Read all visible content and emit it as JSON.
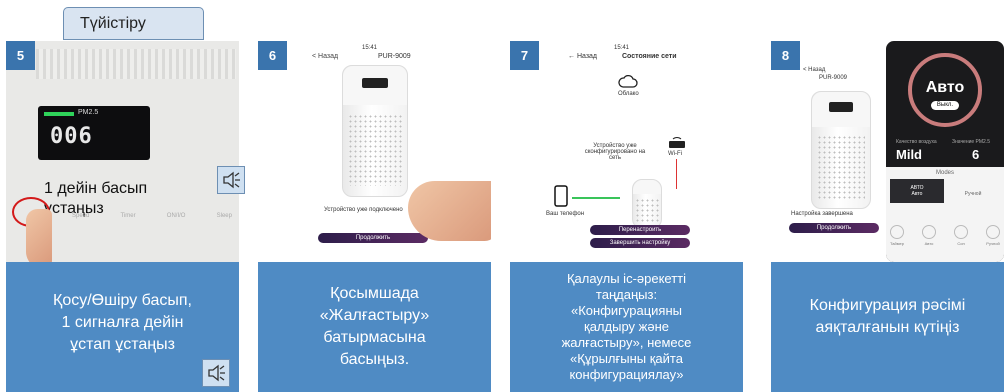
{
  "tab_label": "Түйістіру",
  "colors": {
    "panel_bg": "#4f8bc4",
    "badge_bg": "#3a74ad",
    "caption_text": "#ffffff"
  },
  "icons": {
    "speaker": "speaker-icon"
  },
  "panels": [
    {
      "number": "5",
      "caption": "Қосу/Өшіру басып,\n1 сигналға дейін\nұстап ұстаңыз",
      "device": {
        "pm_label": "PM2.5",
        "display_value": "006",
        "press_text": "1 дейін басып\nұстаңыз",
        "labels": [
          "Speed",
          "Timer",
          "ON/I/O",
          "Sleep"
        ]
      }
    },
    {
      "number": "6",
      "caption": "Қосымшада\n«Жалғастыру»\nбатырмасына\nбасыңыз.",
      "phone": {
        "time": "15:41",
        "back": "< Назад",
        "model": "PUR-9009",
        "message": "Устройство уже подключено",
        "button": "Продолжить"
      }
    },
    {
      "number": "7",
      "caption": "Қалаулы іс-әрекетті\nтаңдаңыз:\n«Конфигурацияны\nқалдыру және\nжалғастыру», немесе\n«Құрылғыны қайта\nконфигурациялау»",
      "phone": {
        "time": "15:41",
        "back": "← Назад",
        "title": "Состояние сети",
        "cloud_label": "Облако",
        "status_text": "Устройство уже\nсконфигурировано на сеть",
        "router_label": "Wi-Fi",
        "phone_label": "Ваш телефон",
        "button_primary": "Перенастроить",
        "button_secondary": "Завершить настройку"
      }
    },
    {
      "number": "8",
      "caption": "Конфигурация рәсімі\nаяқталғанын күтіңіз",
      "phone": {
        "back": "< Назад",
        "model": "PUR-9009",
        "done_text": "Настройка завершена",
        "button": "Продолжить",
        "mode": "Авто",
        "mode_button": "Выкл.",
        "air_quality_label": "Качество воздуха",
        "air_quality": "Mild",
        "pm_label": "Значение PM2.5",
        "pm_value": "6",
        "modes_title": "Modes",
        "mode_a": "АВТО",
        "mode_a_sub": "Авто",
        "mode_b": "Ручной",
        "bottom_icons": [
          "Таймер",
          "Авто",
          "Сон",
          "Ручной"
        ]
      }
    }
  ]
}
